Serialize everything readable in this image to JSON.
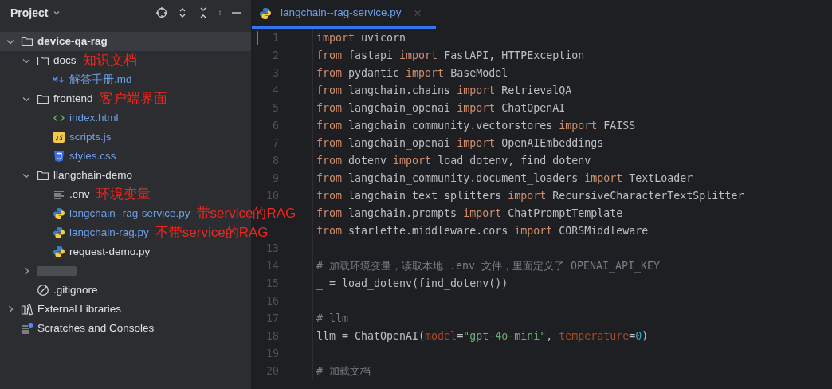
{
  "sidebar": {
    "title": "Project",
    "tree": [
      {
        "label": "device-qa-rag",
        "kind": "folder",
        "expanded": true,
        "selected": true,
        "children": [
          {
            "label": "docs",
            "kind": "folder",
            "expanded": true,
            "note": "知识文档",
            "children": [
              {
                "label": "解答手册.md",
                "kind": "markdown",
                "modified": true
              }
            ]
          },
          {
            "label": "frontend",
            "kind": "folder",
            "expanded": true,
            "note": "客户端界面",
            "children": [
              {
                "label": "index.html",
                "kind": "html",
                "modified": true
              },
              {
                "label": "scripts.js",
                "kind": "js",
                "modified": true
              },
              {
                "label": "styles.css",
                "kind": "css",
                "modified": true
              }
            ]
          },
          {
            "label": "llangchain-demo",
            "kind": "folder",
            "expanded": true,
            "children": [
              {
                "label": ".env",
                "kind": "text",
                "modified": false,
                "note": "环境变量"
              },
              {
                "label": "langchain--rag-service.py",
                "kind": "python",
                "modified": true,
                "note": "带service的RAG"
              },
              {
                "label": "langchain-rag.py",
                "kind": "python",
                "modified": true,
                "note": "不带service的RAG"
              },
              {
                "label": "request-demo.py",
                "kind": "python",
                "modified": false
              }
            ]
          },
          {
            "kind": "redacted",
            "expanded": false
          },
          {
            "label": ".gitignore",
            "kind": "ignore",
            "modified": false
          }
        ]
      },
      {
        "label": "External Libraries",
        "kind": "library",
        "expanded": false
      },
      {
        "label": "Scratches and Consoles",
        "kind": "scratches"
      }
    ]
  },
  "editor": {
    "tabs": [
      {
        "label": "langchain--rag-service.py",
        "selected": true,
        "modified": true
      }
    ],
    "lines": [
      {
        "number": "1",
        "color": "#549159",
        "tokens": [
          {
            "kind": "kw",
            "t": "import"
          },
          {
            "kind": "plain",
            "t": " uvicorn"
          }
        ]
      },
      {
        "number": "2",
        "tokens": [
          {
            "kind": "kw",
            "t": "from"
          },
          {
            "kind": "plain",
            "t": " fastapi "
          },
          {
            "kind": "kw",
            "t": "import"
          },
          {
            "kind": "plain",
            "t": " FastAPI, HTTPException"
          }
        ]
      },
      {
        "number": "3",
        "tokens": [
          {
            "kind": "kw",
            "t": "from"
          },
          {
            "kind": "plain",
            "t": " pydantic "
          },
          {
            "kind": "kw",
            "t": "import"
          },
          {
            "kind": "plain",
            "t": " BaseModel"
          }
        ]
      },
      {
        "number": "4",
        "tokens": [
          {
            "kind": "kw",
            "t": "from"
          },
          {
            "kind": "plain",
            "t": " langchain.chains "
          },
          {
            "kind": "kw",
            "t": "import"
          },
          {
            "kind": "plain",
            "t": " RetrievalQA"
          }
        ]
      },
      {
        "number": "5",
        "tokens": [
          {
            "kind": "kw",
            "t": "from"
          },
          {
            "kind": "plain",
            "t": " langchain_openai "
          },
          {
            "kind": "kw",
            "t": "import"
          },
          {
            "kind": "plain",
            "t": " ChatOpenAI"
          }
        ]
      },
      {
        "number": "6",
        "tokens": [
          {
            "kind": "kw",
            "t": "from"
          },
          {
            "kind": "plain",
            "t": " langchain_community.vectorstores "
          },
          {
            "kind": "kw",
            "t": "import"
          },
          {
            "kind": "plain",
            "t": " FAISS"
          }
        ]
      },
      {
        "number": "7",
        "tokens": [
          {
            "kind": "kw",
            "t": "from"
          },
          {
            "kind": "plain",
            "t": " langchain_openai "
          },
          {
            "kind": "kw",
            "t": "import"
          },
          {
            "kind": "plain",
            "t": " OpenAIEmbeddings"
          }
        ]
      },
      {
        "number": "8",
        "tokens": [
          {
            "kind": "kw",
            "t": "from"
          },
          {
            "kind": "plain",
            "t": " dotenv "
          },
          {
            "kind": "kw",
            "t": "import"
          },
          {
            "kind": "plain",
            "t": " load_dotenv, find_dotenv"
          }
        ]
      },
      {
        "number": "9",
        "tokens": [
          {
            "kind": "kw",
            "t": "from"
          },
          {
            "kind": "plain",
            "t": " langchain_community.document_loaders "
          },
          {
            "kind": "kw",
            "t": "import"
          },
          {
            "kind": "plain",
            "t": " TextLoader"
          }
        ]
      },
      {
        "number": "10",
        "tokens": [
          {
            "kind": "kw",
            "t": "from"
          },
          {
            "kind": "plain",
            "t": " langchain_text_splitters "
          },
          {
            "kind": "kw",
            "t": "import"
          },
          {
            "kind": "plain",
            "t": " RecursiveCharacterTextSplitter"
          }
        ]
      },
      {
        "tokens": [
          {
            "kind": "kw",
            "t": "from"
          },
          {
            "kind": "plain",
            "t": " langchain.prompts "
          },
          {
            "kind": "kw",
            "t": "import"
          },
          {
            "kind": "plain",
            "t": " ChatPromptTemplate"
          }
        ]
      },
      {
        "tokens": [
          {
            "kind": "kw",
            "t": "from"
          },
          {
            "kind": "plain",
            "t": " starlette.middleware.cors "
          },
          {
            "kind": "kw",
            "t": "import"
          },
          {
            "kind": "plain",
            "t": " CORSMiddleware"
          }
        ]
      },
      {
        "number": "13"
      },
      {
        "number": "14",
        "tokens": [
          {
            "kind": "comment",
            "t": "# 加载环境变量，读取本地 .env 文件，里面定义了 OPENAI_API_KEY"
          }
        ]
      },
      {
        "number": "15",
        "tokens": [
          {
            "kind": "plain",
            "t": "_ = load_dotenv(find_dotenv())"
          }
        ]
      },
      {
        "number": "16"
      },
      {
        "number": "17",
        "tokens": [
          {
            "kind": "comment",
            "t": "# llm"
          }
        ]
      },
      {
        "number": "18",
        "tokens": [
          {
            "kind": "plain",
            "t": "llm = ChatOpenAI("
          },
          {
            "kind": "param",
            "t": "model"
          },
          {
            "kind": "plain",
            "t": "="
          },
          {
            "kind": "string",
            "t": "\"gpt-4o-mini\""
          },
          {
            "kind": "plain",
            "t": ", "
          },
          {
            "kind": "param",
            "t": "temperature"
          },
          {
            "kind": "plain",
            "t": "="
          },
          {
            "kind": "number",
            "t": "0"
          },
          {
            "kind": "plain",
            "t": ")"
          }
        ]
      },
      {
        "number": "19"
      },
      {
        "number": "20",
        "tokens": [
          {
            "kind": "comment",
            "t": "# 加载文档"
          }
        ]
      }
    ]
  }
}
